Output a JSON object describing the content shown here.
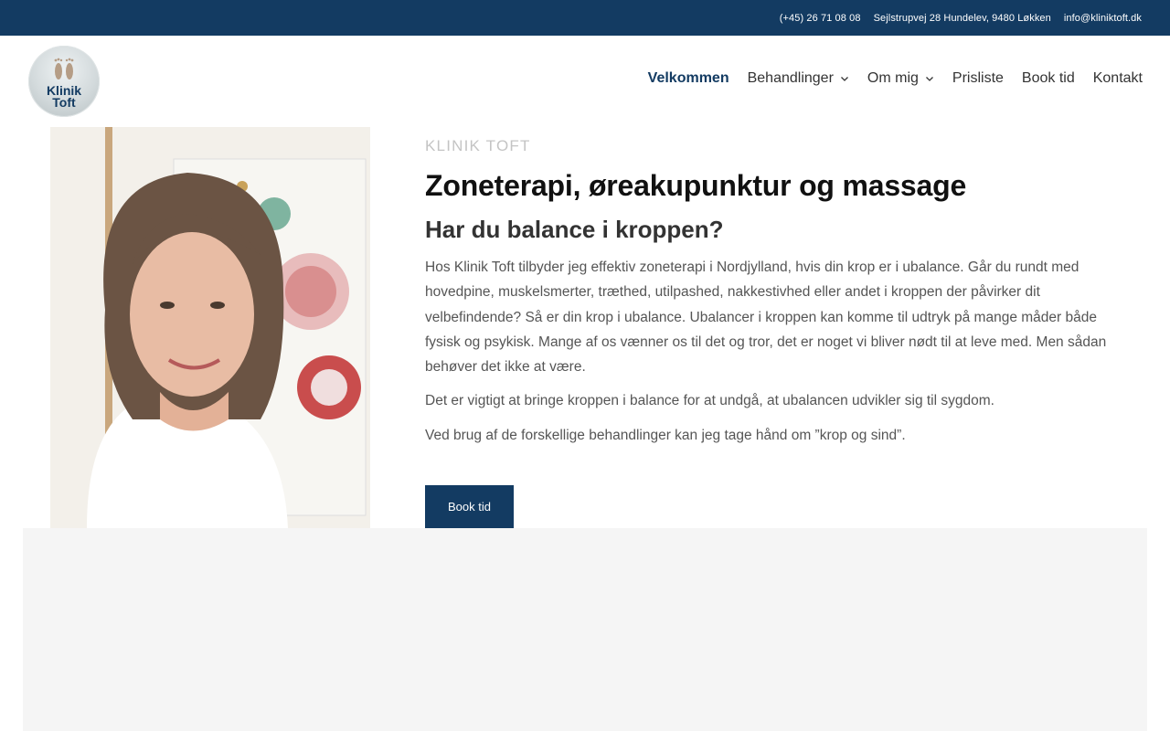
{
  "topbar": {
    "phone": "(+45) 26 71 08 08",
    "address": "Sejlstrupvej 28 Hundelev, 9480 Løkken",
    "email": "info@kliniktoft.dk"
  },
  "logo": {
    "line1": "Klinik",
    "line2": "Toft"
  },
  "nav": {
    "items": [
      {
        "label": "Velkommen"
      },
      {
        "label": "Behandlinger"
      },
      {
        "label": "Om mig"
      },
      {
        "label": "Prisliste"
      },
      {
        "label": "Book tid"
      },
      {
        "label": "Kontakt"
      }
    ]
  },
  "main": {
    "eyebrow": "KLINIK TOFT",
    "title": "Zoneterapi, øreakupunktur og massage",
    "subtitle": "Har du balance i kroppen?",
    "paragraphs": [
      "Hos Klinik Toft tilbyder jeg effektiv zoneterapi i Nordjylland, hvis din krop er i ubalance. Går du rundt med hovedpine, muskelsmerter, træthed, utilpashed, nakkestivhed eller andet i kroppen der påvirker dit velbefindende? Så er din krop i ubalance. Ubalancer i kroppen kan komme til udtryk på mange måder både fysisk og psykisk. Mange af os vænner os til det og tror, det er noget vi bliver nødt til at leve med. Men sådan behøver det ikke at være.",
      "Det er vigtigt at bringe kroppen i balance for at undgå, at ubalancen udvikler sig til sygdom.",
      "Ved brug af de forskellige behandlinger kan jeg tage hånd om ”krop og sind”."
    ],
    "button": "Book tid"
  },
  "colors": {
    "brand": "#133b62",
    "graySection": "#f5f5f5"
  }
}
